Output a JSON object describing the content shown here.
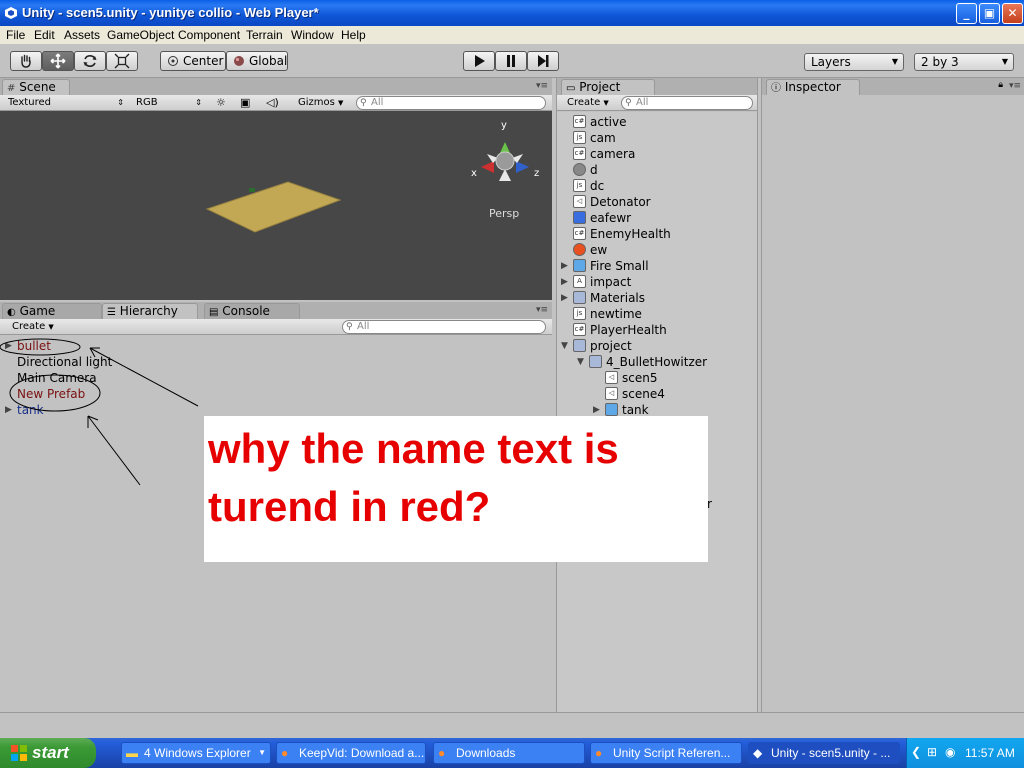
{
  "window": {
    "title": "Unity - scen5.unity - yunitye collio - Web Player*"
  },
  "menu": [
    "File",
    "Edit",
    "Assets",
    "GameObject",
    "Component",
    "Terrain",
    "Window",
    "Help"
  ],
  "toolbar": {
    "tools": [
      "hand-icon",
      "move-icon",
      "rotate-icon",
      "scale-icon"
    ],
    "center_label": "Center",
    "global_label": "Global",
    "layers_label": "Layers",
    "layout_label": "2 by 3"
  },
  "scene": {
    "tab": "Scene",
    "render_mode": "Textured",
    "color_mode": "RGB",
    "gizmos_label": "Gizmos",
    "search_placeholder": "All",
    "persp_label": "Persp",
    "axis_x": "x",
    "axis_y": "y",
    "axis_z": "z"
  },
  "bottom_tabs": {
    "game": "Game",
    "hierarchy": "Hierarchy",
    "console": "Console"
  },
  "hierarchy": {
    "create_label": "Create",
    "search_placeholder": "All",
    "items": [
      {
        "name": "bullet",
        "expandable": true,
        "color": "#7a1010"
      },
      {
        "name": "Directional light",
        "expandable": false,
        "color": "#000000"
      },
      {
        "name": "Main Camera",
        "expandable": false,
        "color": "#000000"
      },
      {
        "name": "New Prefab",
        "expandable": false,
        "color": "#7a1010"
      },
      {
        "name": "tank",
        "expandable": true,
        "color": "#1a2f8a"
      }
    ]
  },
  "project": {
    "tab": "Project",
    "create_label": "Create",
    "search_placeholder": "All",
    "items": [
      {
        "name": "active",
        "icon": "cs"
      },
      {
        "name": "cam",
        "icon": "js"
      },
      {
        "name": "camera",
        "icon": "cs"
      },
      {
        "name": "d",
        "icon": "sphere"
      },
      {
        "name": "dc",
        "icon": "js"
      },
      {
        "name": "Detonator",
        "icon": "unity"
      },
      {
        "name": "eafewr",
        "icon": "texture"
      },
      {
        "name": "EnemyHealth",
        "icon": "cs"
      },
      {
        "name": "ew",
        "icon": "material"
      },
      {
        "name": "Fire Small",
        "icon": "prefab"
      },
      {
        "name": "impact",
        "icon": "font"
      },
      {
        "name": "Materials",
        "icon": "folder"
      },
      {
        "name": "newtime",
        "icon": "js"
      },
      {
        "name": "PlayerHealth",
        "icon": "cs"
      },
      {
        "name": "project",
        "icon": "folder"
      },
      {
        "name": "4_BulletHowitzer",
        "icon": "folder"
      },
      {
        "name": "scen5",
        "icon": "unity"
      },
      {
        "name": "scene4",
        "icon": "unity"
      },
      {
        "name": "tank",
        "icon": "prefab"
      }
    ],
    "partial_text": "r"
  },
  "inspector": {
    "tab": "Inspector"
  },
  "annotation": {
    "text": "why the name  text is turend in red?",
    "color": "#e60000"
  },
  "taskbar": {
    "start": "start",
    "tasks": [
      "4 Windows Explorer",
      "KeepVid: Download a...",
      "Downloads",
      "Unity Script Referen...",
      "Unity - scen5.unity - ..."
    ],
    "clock": "11:57 AM"
  }
}
